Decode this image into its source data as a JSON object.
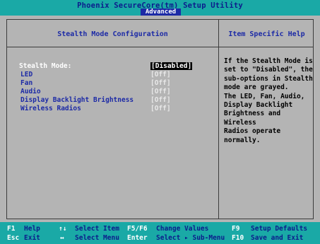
{
  "header": {
    "title": "Phoenix SecureCore(tm) Setup Utility",
    "active_tab": "Advanced"
  },
  "left_panel": {
    "title": "Stealth Mode Configuration",
    "options": [
      {
        "label": "Stealth Mode:",
        "value": "[Disabled]",
        "selected": true
      },
      {
        "label": "LED",
        "value": "[Off]"
      },
      {
        "label": "Fan",
        "value": "[Off]"
      },
      {
        "label": "Audio",
        "value": "[Off]"
      },
      {
        "label": "Display Backlight Brightness",
        "value": "[Off]"
      },
      {
        "label": "Wireless Radios",
        "value": "[Off]"
      }
    ]
  },
  "right_panel": {
    "title": "Item Specific Help",
    "help_text": "If the Stealth Mode is\nset to \"Disabled\", the\nsub-options in Stealth\nmode are grayed.\nThe LED, Fan, Audio,\nDisplay Backlight\nBrightness and Wireless\nRadios operate normally."
  },
  "footer": {
    "rows": [
      [
        {
          "key": "F1",
          "desc": "Help"
        },
        {
          "key": "↑↓",
          "desc": "Select Item"
        },
        {
          "key": "F5/F6",
          "desc": "Change Values"
        },
        {
          "key": "F9",
          "desc": "Setup Defaults"
        }
      ],
      [
        {
          "key": "Esc",
          "desc": "Exit"
        },
        {
          "key": "↔",
          "desc": "Select Menu"
        },
        {
          "key": "Enter",
          "desc": "Select ▸ Sub-Menu"
        },
        {
          "key": "F10",
          "desc": "Save and Exit"
        }
      ]
    ]
  },
  "colors": {
    "background": "#151f99",
    "bar": "#1aa9a6",
    "panel": "#b4b4b4",
    "title_text": "#0c1c8c",
    "option_blue": "#1c2aa6",
    "selected_bg": "#000000"
  }
}
